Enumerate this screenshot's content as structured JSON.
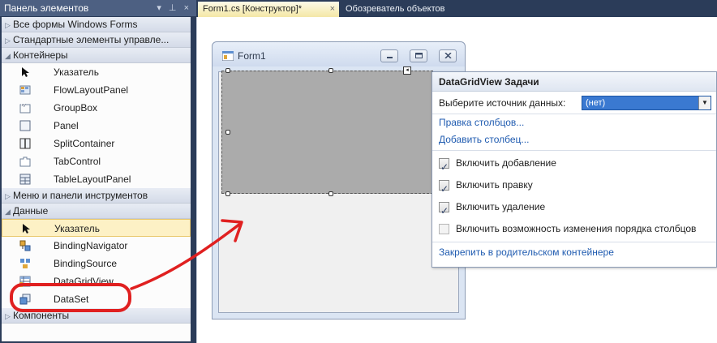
{
  "toolbox": {
    "title": "Панель элементов",
    "title_controls": "▾ ⊥ ×",
    "groups_top": [
      {
        "label": "Все формы Windows Forms",
        "expanded": false
      },
      {
        "label": "Стандартные элементы управле...",
        "expanded": false
      },
      {
        "label": "Контейнеры",
        "expanded": true
      }
    ],
    "containers_items": [
      {
        "label": "Указатель",
        "icon": "pointer-icon"
      },
      {
        "label": "FlowLayoutPanel",
        "icon": "flowlayoutpanel-icon"
      },
      {
        "label": "GroupBox",
        "icon": "groupbox-icon"
      },
      {
        "label": "Panel",
        "icon": "panel-icon"
      },
      {
        "label": "SplitContainer",
        "icon": "splitcontainer-icon"
      },
      {
        "label": "TabControl",
        "icon": "tabcontrol-icon"
      },
      {
        "label": "TableLayoutPanel",
        "icon": "tablelayoutpanel-icon"
      }
    ],
    "group_menu": {
      "label": "Меню и панели инструментов",
      "expanded": false
    },
    "group_data": {
      "label": "Данные",
      "expanded": true
    },
    "data_items": [
      {
        "label": "Указатель",
        "icon": "pointer-icon",
        "selected": true
      },
      {
        "label": "BindingNavigator",
        "icon": "bindingnavigator-icon"
      },
      {
        "label": "BindingSource",
        "icon": "bindingsource-icon"
      },
      {
        "label": "DataGridView",
        "icon": "datagridview-icon"
      },
      {
        "label": "DataSet",
        "icon": "dataset-icon"
      }
    ],
    "group_components": {
      "label": "Компоненты",
      "expanded": false
    }
  },
  "tabs": {
    "active": "Form1.cs [Конструктор]*",
    "active_close": "×",
    "inactive": "Обозреватель объектов"
  },
  "form": {
    "title": "Form1"
  },
  "tasks": {
    "header": "DataGridView Задачи",
    "source_label": "Выберите источник данных:",
    "source_value": "(нет)",
    "edit_columns": "Правка столбцов...",
    "add_column": "Добавить столбец...",
    "checkboxes": [
      {
        "label": "Включить добавление",
        "checked": true
      },
      {
        "label": "Включить правку",
        "checked": true
      },
      {
        "label": "Включить удаление",
        "checked": true
      },
      {
        "label": "Включить возможность изменения порядка столбцов",
        "checked": false
      }
    ],
    "dock_link": "Закрепить в родительском контейнере"
  },
  "colors": {
    "vs_chrome": "#2b3c59",
    "selection_fill": "#fdf1c5",
    "annotation_red": "#e02020",
    "link_blue": "#1f5bb0",
    "combo_highlight": "#3a79d1"
  }
}
